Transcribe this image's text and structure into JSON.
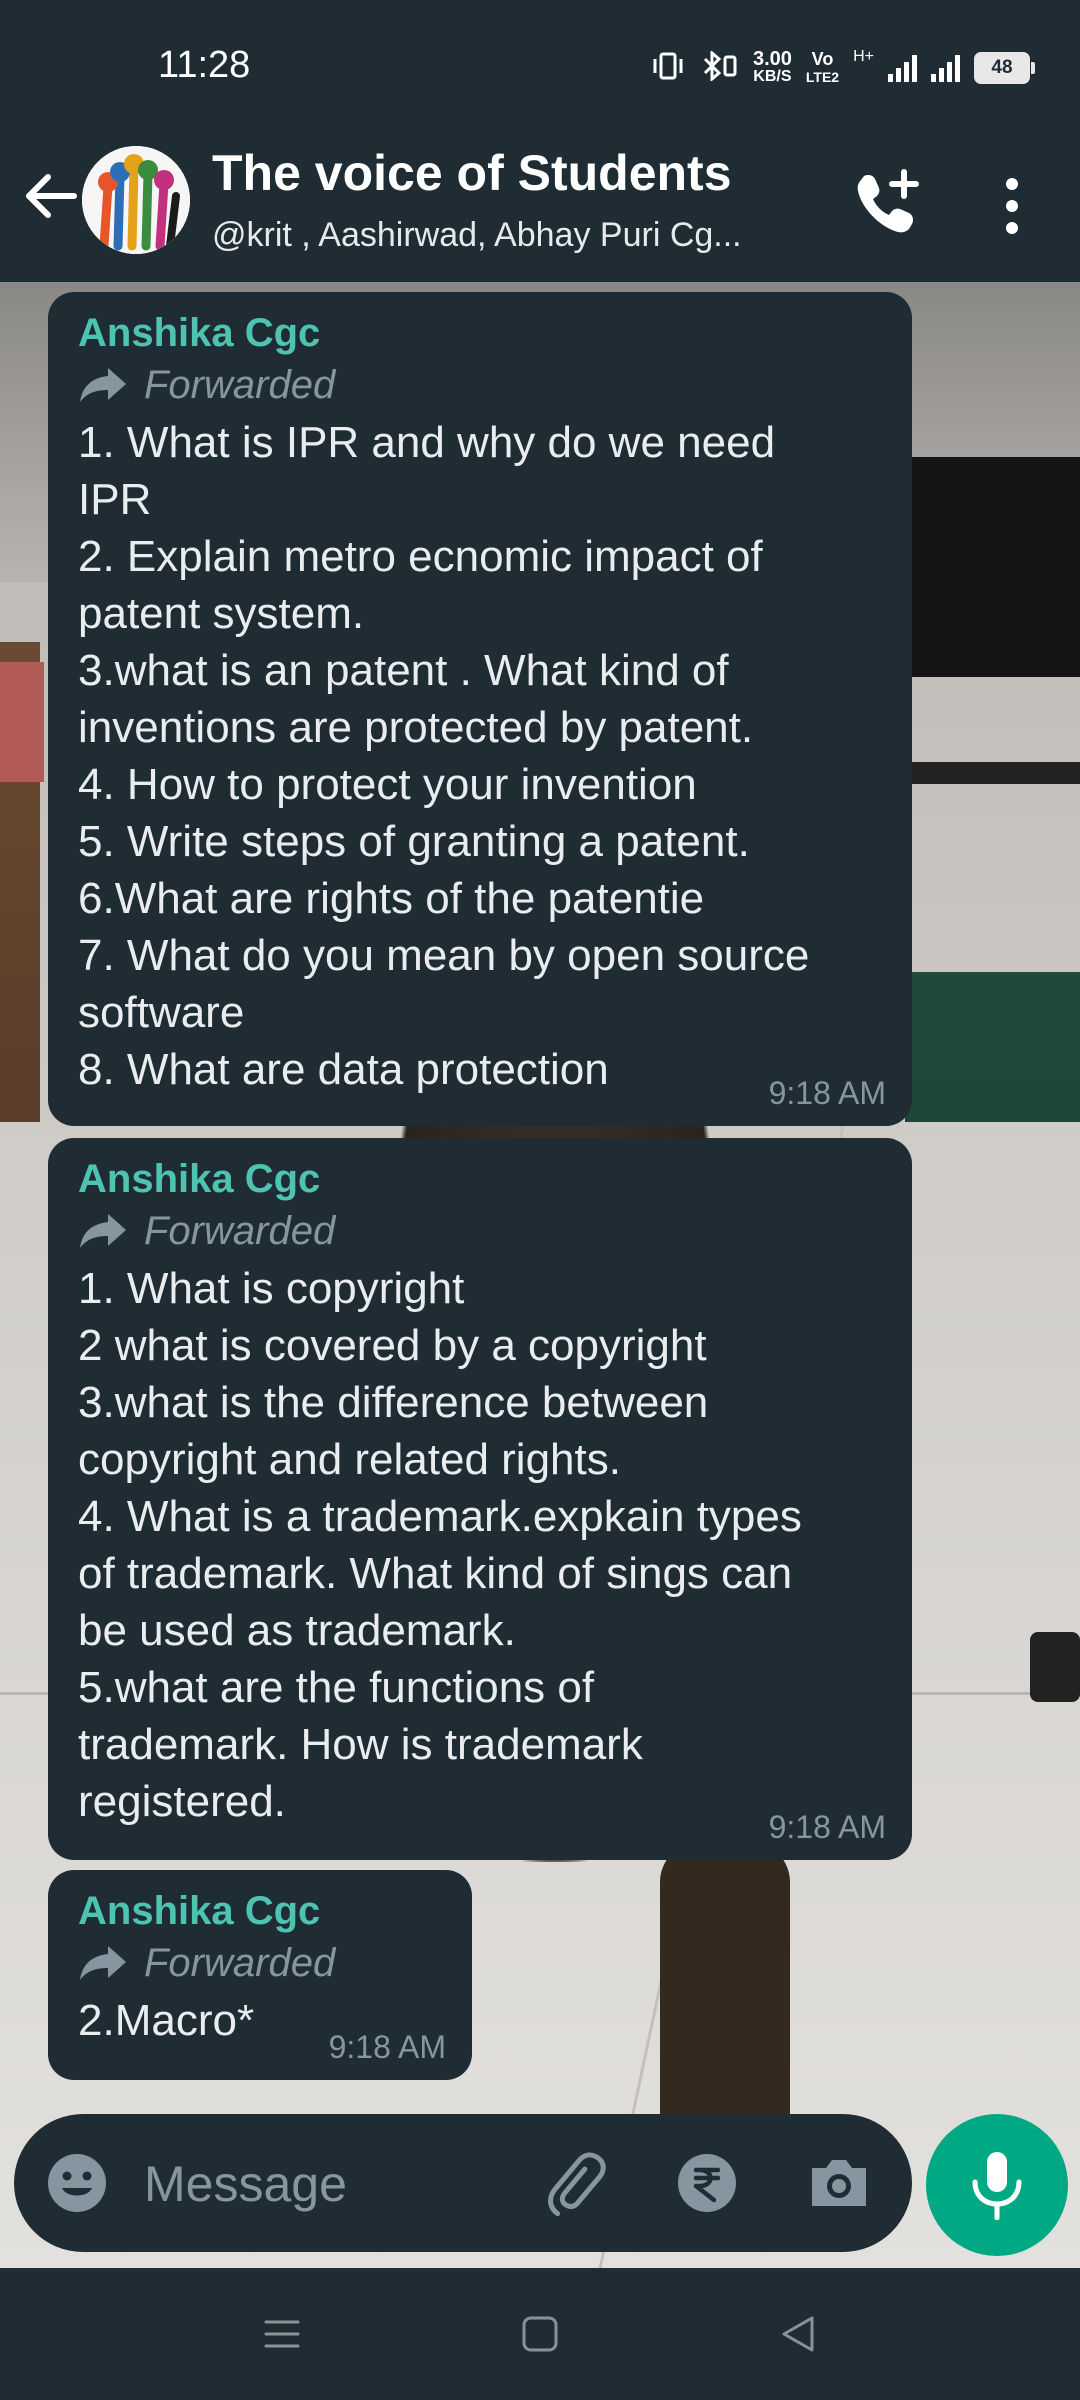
{
  "status_bar": {
    "time": "11:28",
    "net_speed_value": "3.00",
    "net_speed_unit": "KB/S",
    "volte_label_top": "Vo",
    "volte_label_bottom": "LTE2",
    "network_type": "H+",
    "battery_level": "48"
  },
  "header": {
    "title": "The voice of Students",
    "members": "@krit , Aashirwad, Abhay Puri Cg..."
  },
  "messages": [
    {
      "sender": "Anshika Cgc",
      "forwarded_label": "Forwarded",
      "text": "1. What is IPR and why do we need\nIPR\n2. Explain metro ecnomic impact of\npatent system.\n3.what is an patent . What kind of\ninventions are protected by patent.\n4. How to protect your invention\n5. Write steps of granting a patent.\n6.What are rights of the patentie\n7. What do you mean by open source\nsoftware\n8. What are data protection",
      "time": "9:18 AM"
    },
    {
      "sender": "Anshika Cgc",
      "forwarded_label": "Forwarded",
      "text": "1. What is copyright\n2 what is covered by a copyright\n3.what is the difference between\ncopyright and related rights.\n4. What is a trademark.expkain types\nof trademark. What kind of sings can\nbe used as trademark.\n5.what are the functions of\ntrademark. How is trademark\nregistered.",
      "time": "9:18 AM"
    },
    {
      "sender": "Anshika Cgc",
      "forwarded_label": "Forwarded",
      "text": "2.Macro*",
      "time": "9:18 AM"
    }
  ],
  "composer": {
    "placeholder": "Message",
    "value": ""
  },
  "colors": {
    "bar_bg": "#1f2c34",
    "bubble_bg": "#1f2c34",
    "sender_name": "#4fc3b1",
    "accent_green": "#00a884",
    "meta_gray": "#8696a0"
  },
  "icons": {
    "header": [
      "back-arrow-icon",
      "group-avatar",
      "add-call-icon",
      "more-vert-icon"
    ],
    "composer": [
      "emoji-icon",
      "attach-icon",
      "rupee-payment-icon",
      "camera-icon",
      "mic-icon"
    ],
    "nav": [
      "recent-apps-icon",
      "home-icon",
      "back-icon"
    ]
  }
}
